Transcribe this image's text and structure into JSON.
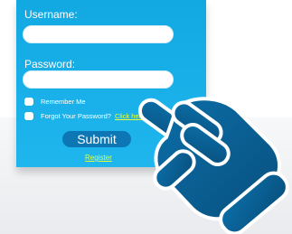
{
  "login_form": {
    "username_label": "Username:",
    "username_value": "",
    "password_label": "Password:",
    "password_value": "",
    "remember_me_label": "Remember Me",
    "forgot_password_text": "Forgot Your Password?",
    "forgot_password_link": "Click here.",
    "submit_label": "Submit",
    "register_link": "Register"
  },
  "colors": {
    "panel": "#12a8e2",
    "button": "#0d77b6",
    "link": "#e7ff3a",
    "hand": "#0a5f96"
  },
  "icons": {
    "pointer": "pointing-hand-icon"
  }
}
